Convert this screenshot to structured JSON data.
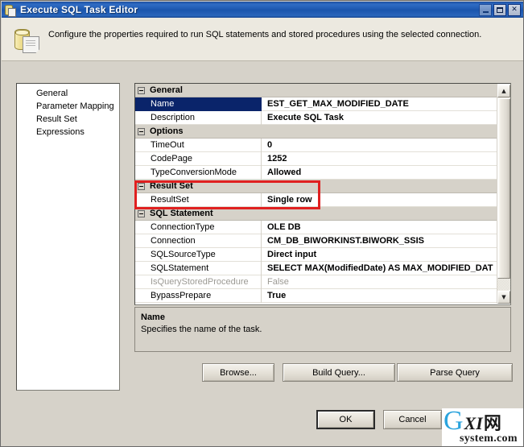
{
  "window": {
    "title": "Execute SQL Task Editor",
    "icon": "sql-task-icon",
    "controls": {
      "minimize": "minimize-button",
      "maximize": "maximize-button",
      "close": "close-button",
      "close_glyph": "✕"
    }
  },
  "header": {
    "icon": "sql-task-large-icon",
    "description": "Configure the properties required to run SQL statements and stored procedures using the selected connection."
  },
  "sidebar": {
    "items": [
      {
        "label": "General",
        "selected": true
      },
      {
        "label": "Parameter Mapping",
        "selected": false
      },
      {
        "label": "Result Set",
        "selected": false
      },
      {
        "label": "Expressions",
        "selected": false
      }
    ]
  },
  "grid": {
    "rows": [
      {
        "kind": "category",
        "label": "General",
        "expanded": true
      },
      {
        "kind": "property",
        "name": "Name",
        "value": "EST_GET_MAX_MODIFIED_DATE",
        "selected": true,
        "disabled": false
      },
      {
        "kind": "property",
        "name": "Description",
        "value": "Execute SQL Task",
        "selected": false,
        "disabled": false
      },
      {
        "kind": "category",
        "label": "Options",
        "expanded": true
      },
      {
        "kind": "property",
        "name": "TimeOut",
        "value": "0",
        "selected": false,
        "disabled": false
      },
      {
        "kind": "property",
        "name": "CodePage",
        "value": "1252",
        "selected": false,
        "disabled": false
      },
      {
        "kind": "property",
        "name": "TypeConversionMode",
        "value": "Allowed",
        "selected": false,
        "disabled": false
      },
      {
        "kind": "category",
        "label": "Result Set",
        "expanded": true
      },
      {
        "kind": "property",
        "name": "ResultSet",
        "value": "Single row",
        "selected": false,
        "disabled": false
      },
      {
        "kind": "category",
        "label": "SQL Statement",
        "expanded": true
      },
      {
        "kind": "property",
        "name": "ConnectionType",
        "value": "OLE DB",
        "selected": false,
        "disabled": false
      },
      {
        "kind": "property",
        "name": "Connection",
        "value": "CM_DB_BIWORKINST.BIWORK_SSIS",
        "selected": false,
        "disabled": false
      },
      {
        "kind": "property",
        "name": "SQLSourceType",
        "value": "Direct input",
        "selected": false,
        "disabled": false
      },
      {
        "kind": "property",
        "name": "SQLStatement",
        "value": "SELECT MAX(ModifiedDate) AS MAX_MODIFIED_DAT",
        "selected": false,
        "disabled": false
      },
      {
        "kind": "property",
        "name": "IsQueryStoredProcedure",
        "value": "False",
        "selected": false,
        "disabled": true
      },
      {
        "kind": "property",
        "name": "BypassPrepare",
        "value": "True",
        "selected": false,
        "disabled": false
      }
    ],
    "scrollbar": {
      "up_glyph": "▲",
      "down_glyph": "▼"
    },
    "highlight": {
      "color": "#e02020",
      "target": "Result Set"
    }
  },
  "description_pane": {
    "title": "Name",
    "text": "Specifies the name of the task."
  },
  "buttons": {
    "browse": "Browse...",
    "build_query": "Build Query...",
    "parse_query": "Parse Query",
    "ok": "OK",
    "cancel": "Cancel"
  },
  "watermark": {
    "g": "G",
    "xi": "XI",
    "cn": "网",
    "domain": "system.com"
  }
}
